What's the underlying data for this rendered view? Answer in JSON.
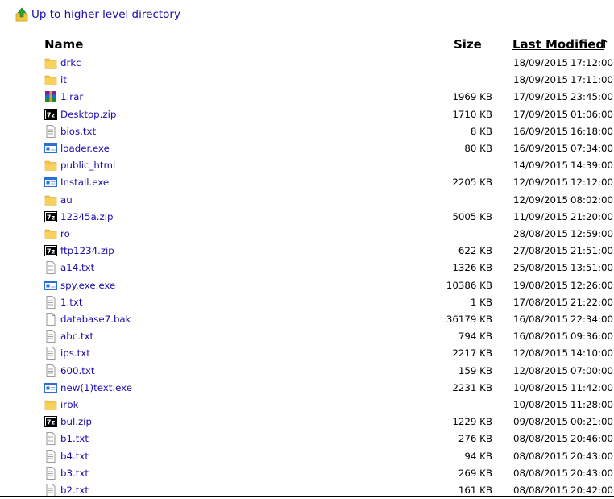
{
  "up_link": {
    "label": "Up to higher level directory"
  },
  "headers": {
    "name": "Name",
    "size": "Size",
    "modified": "Last Modified",
    "sort_arrow": "↑"
  },
  "colors": {
    "link": "#1a0dab",
    "folder": "#f5c542",
    "archive": "#000000",
    "exe": "#2a6fd6"
  },
  "files": [
    {
      "name": "drkc",
      "size": "",
      "date": "18/09/2015",
      "time": "17:12:00",
      "icon": "folder-icon"
    },
    {
      "name": "it",
      "size": "",
      "date": "18/09/2015",
      "time": "17:11:00",
      "icon": "folder-icon"
    },
    {
      "name": "1.rar",
      "size": "1969 KB",
      "date": "17/09/2015",
      "time": "23:45:00",
      "icon": "rar-icon"
    },
    {
      "name": "Desktop.zip",
      "size": "1710 KB",
      "date": "17/09/2015",
      "time": "01:06:00",
      "icon": "7z-icon"
    },
    {
      "name": "bios.txt",
      "size": "8 KB",
      "date": "16/09/2015",
      "time": "16:18:00",
      "icon": "text-file-icon"
    },
    {
      "name": "loader.exe",
      "size": "80 KB",
      "date": "16/09/2015",
      "time": "07:34:00",
      "icon": "exe-icon"
    },
    {
      "name": "public_html",
      "size": "",
      "date": "14/09/2015",
      "time": "14:39:00",
      "icon": "folder-icon"
    },
    {
      "name": "Install.exe",
      "size": "2205 KB",
      "date": "12/09/2015",
      "time": "12:12:00",
      "icon": "exe-icon"
    },
    {
      "name": "au",
      "size": "",
      "date": "12/09/2015",
      "time": "08:02:00",
      "icon": "folder-icon"
    },
    {
      "name": "12345a.zip",
      "size": "5005 KB",
      "date": "11/09/2015",
      "time": "21:20:00",
      "icon": "7z-icon"
    },
    {
      "name": "ro",
      "size": "",
      "date": "28/08/2015",
      "time": "12:59:00",
      "icon": "folder-icon"
    },
    {
      "name": "ftp1234.zip",
      "size": "622 KB",
      "date": "27/08/2015",
      "time": "21:51:00",
      "icon": "7z-icon"
    },
    {
      "name": "a14.txt",
      "size": "1326 KB",
      "date": "25/08/2015",
      "time": "13:51:00",
      "icon": "text-file-icon"
    },
    {
      "name": "spy.exe.exe",
      "size": "10386 KB",
      "date": "19/08/2015",
      "time": "12:26:00",
      "icon": "exe-icon"
    },
    {
      "name": "1.txt",
      "size": "1 KB",
      "date": "17/08/2015",
      "time": "21:22:00",
      "icon": "text-file-icon"
    },
    {
      "name": "database7.bak",
      "size": "36179 KB",
      "date": "16/08/2015",
      "time": "22:34:00",
      "icon": "blank-file-icon"
    },
    {
      "name": "abc.txt",
      "size": "794 KB",
      "date": "16/08/2015",
      "time": "09:36:00",
      "icon": "text-file-icon"
    },
    {
      "name": "ips.txt",
      "size": "2217 KB",
      "date": "12/08/2015",
      "time": "14:10:00",
      "icon": "text-file-icon"
    },
    {
      "name": "600.txt",
      "size": "159 KB",
      "date": "12/08/2015",
      "time": "07:00:00",
      "icon": "text-file-icon"
    },
    {
      "name": "new(1)text.exe",
      "size": "2231 KB",
      "date": "10/08/2015",
      "time": "11:42:00",
      "icon": "exe-icon"
    },
    {
      "name": "irbk",
      "size": "",
      "date": "10/08/2015",
      "time": "11:28:00",
      "icon": "folder-icon"
    },
    {
      "name": "bul.zip",
      "size": "1229 KB",
      "date": "09/08/2015",
      "time": "00:21:00",
      "icon": "7z-icon"
    },
    {
      "name": "b1.txt",
      "size": "276 KB",
      "date": "08/08/2015",
      "time": "20:46:00",
      "icon": "text-file-icon"
    },
    {
      "name": "b4.txt",
      "size": "94 KB",
      "date": "08/08/2015",
      "time": "20:43:00",
      "icon": "text-file-icon"
    },
    {
      "name": "b3.txt",
      "size": "269 KB",
      "date": "08/08/2015",
      "time": "20:43:00",
      "icon": "text-file-icon"
    },
    {
      "name": "b2.txt",
      "size": "161 KB",
      "date": "08/08/2015",
      "time": "20:42:00",
      "icon": "text-file-icon"
    }
  ]
}
